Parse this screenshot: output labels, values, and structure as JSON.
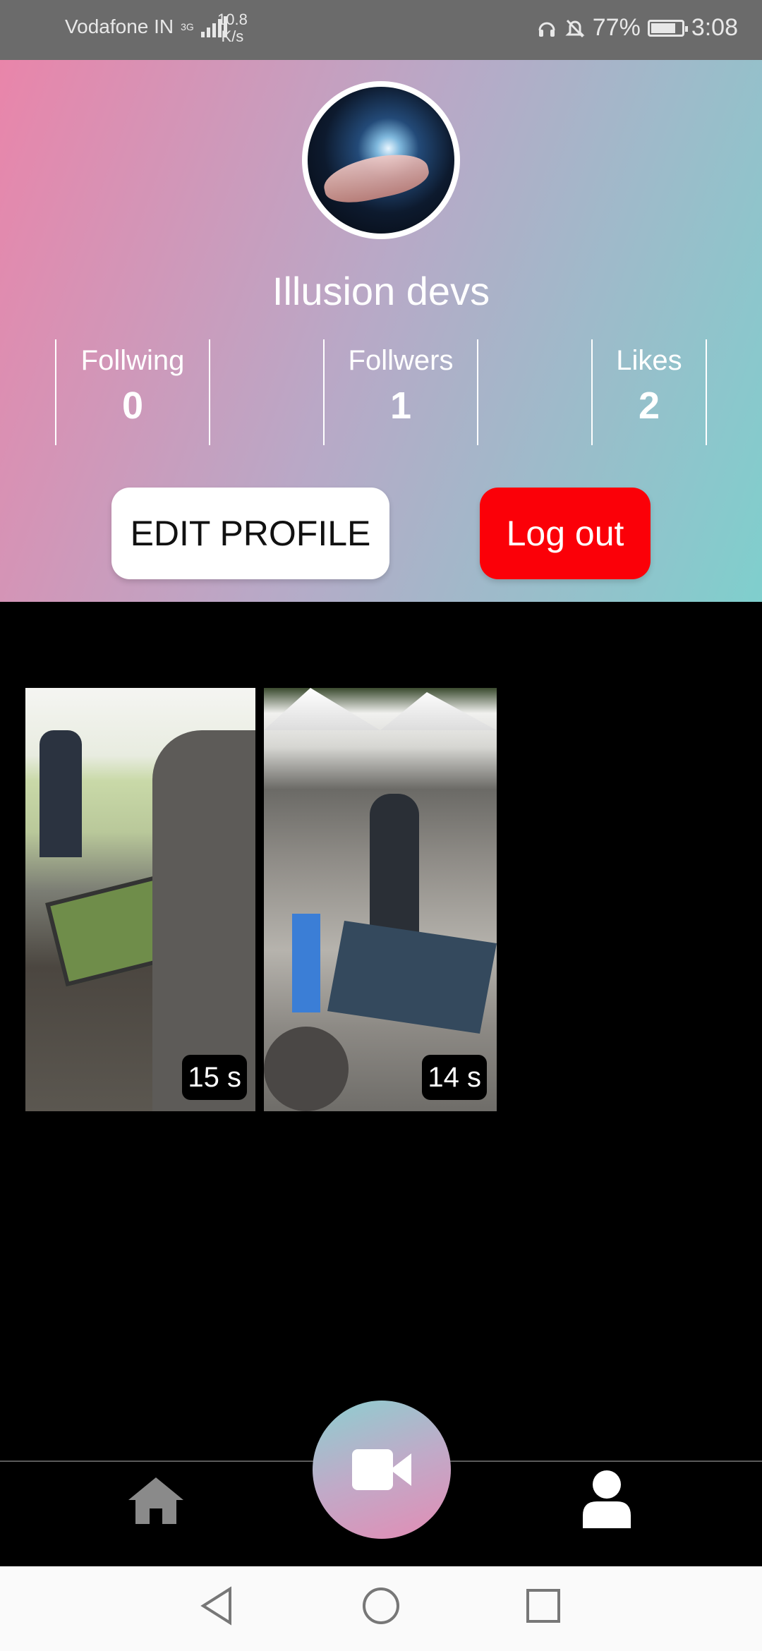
{
  "status_bar": {
    "carrier": "Vodafone IN",
    "network_type": "3G",
    "speed_value": "10.8",
    "speed_unit": "K/s",
    "battery": "77%",
    "time": "3:08"
  },
  "profile": {
    "name": "Illusion devs",
    "stats": [
      {
        "label": "Follwing",
        "value": "0"
      },
      {
        "label": "Follwers",
        "value": "1"
      },
      {
        "label": "Likes",
        "value": "2"
      }
    ],
    "edit_button": "EDIT PROFILE",
    "logout_button": "Log out"
  },
  "videos": [
    {
      "duration": "15 s"
    },
    {
      "duration": "14 s"
    }
  ],
  "bottom_nav": {
    "items": [
      "home-icon",
      "video-camera-icon",
      "user-icon"
    ]
  },
  "colors": {
    "gradient_start": "#e985aa",
    "gradient_end": "#7fcfcd",
    "logout_red": "#fb0008"
  }
}
